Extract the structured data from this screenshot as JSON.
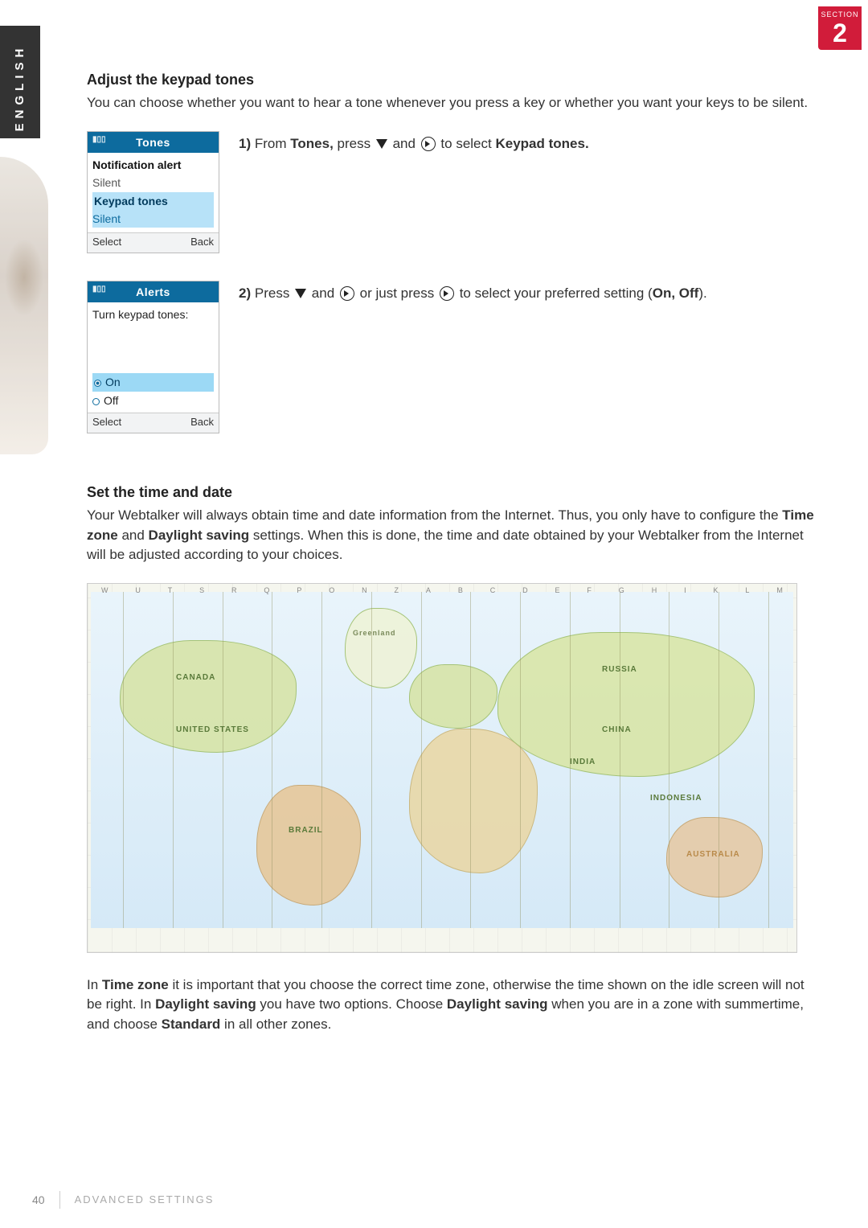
{
  "badge": {
    "label": "SECTION",
    "number": "2"
  },
  "language_tab": "ENGLISH",
  "sec1": {
    "title": "Adjust the keypad tones",
    "intro": "You can choose whether you want to hear a tone whenever you press a key or whether you want your keys to be silent."
  },
  "step1": {
    "prefix": "1)",
    "t1": "From",
    "strong1": "Tones,",
    "t2": "press",
    "t3": "and",
    "t4": "to select",
    "strong2": "Keypad tones."
  },
  "step2": {
    "prefix": "2)",
    "t1": "Press",
    "t2": "and",
    "t3": "or just press",
    "t4": "to select your preferred setting (",
    "strong1": "On, Off",
    "t5": ")."
  },
  "phone1": {
    "title": "Tones",
    "signal": "▮▯▯",
    "item1_label": "Notification alert",
    "item1_value": "Silent",
    "item2_label": "Keypad tones",
    "item2_value": "Silent",
    "sk_left": "Select",
    "sk_right": "Back"
  },
  "phone2": {
    "title": "Alerts",
    "signal": "▮▯▯",
    "heading": "Turn keypad tones:",
    "opt_on": "On",
    "opt_off": "Off",
    "sk_left": "Select",
    "sk_right": "Back"
  },
  "sec2": {
    "title": "Set the time and date",
    "intro_a": "Your Webtalker will always obtain time and date information from the Internet. Thus, you only have to configure the ",
    "intro_b1": "Time zone",
    "intro_c": " and ",
    "intro_b2": "Daylight saving",
    "intro_d": " settings. When this is done, the time and date obtained by your Webtalker from the Internet will be adjusted according to your choices.",
    "after_a": "In ",
    "after_b1": "Time zone",
    "after_c": " it is important that you choose the correct time zone, otherwise the time shown on the idle screen will not be right. In ",
    "after_b2": "Daylight saving",
    "after_d": " you have two options. Choose ",
    "after_b3": "Daylight saving",
    "after_e": " when you are in a zone with summertime, and choose ",
    "after_b4": "Standard",
    "after_f": " in all other zones."
  },
  "map_labels": {
    "canada": "CANADA",
    "us": "UNITED STATES",
    "brazil": "BRAZIL",
    "russia": "RUSSIA",
    "china": "CHINA",
    "india": "INDIA",
    "indonesia": "INDONESIA",
    "australia": "AUSTRALIA",
    "greenland": "Greenland"
  },
  "footer": {
    "page": "40",
    "crumb": "ADVANCED SETTINGS"
  }
}
